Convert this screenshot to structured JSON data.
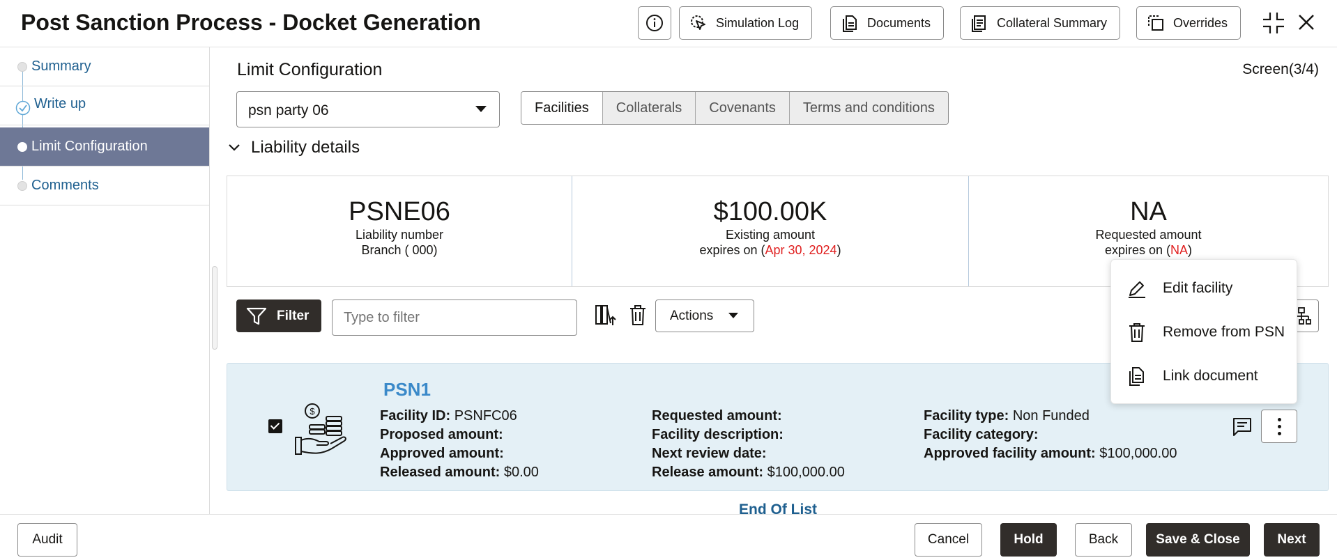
{
  "header": {
    "title": "Post Sanction Process - Docket Generation",
    "buttons": {
      "simulation_log": "Simulation Log",
      "documents": "Documents",
      "collateral_summary": "Collateral Summary",
      "overrides": "Overrides"
    }
  },
  "sidebar": {
    "items": [
      {
        "label": "Summary",
        "state": "pending"
      },
      {
        "label": "Write up",
        "state": "completed"
      },
      {
        "label": "Limit Configuration",
        "state": "active"
      },
      {
        "label": "Comments",
        "state": "pending"
      }
    ]
  },
  "main": {
    "section_title": "Limit Configuration",
    "screen_indicator": "Screen(3/4)",
    "party_select": "psn party 06",
    "tabs": [
      "Facilities",
      "Collaterals",
      "Covenants",
      "Terms and conditions"
    ],
    "liability_header": "Liability details",
    "liability": {
      "number": {
        "value": "PSNE06",
        "label": "Liability number",
        "branch": "Branch ( 000)"
      },
      "existing": {
        "value": "$100.00K",
        "label": "Existing amount",
        "expires_prefix": "expires on (",
        "expires_date": "Apr 30, 2024",
        "expires_suffix": ")"
      },
      "requested": {
        "value": "NA",
        "label": "Requested amount",
        "expires_prefix": "expires on (",
        "expires_date": "NA",
        "expires_suffix": ")"
      }
    },
    "toolbar": {
      "filter_label": "Filter",
      "filter_placeholder": "Type to filter",
      "actions_label": "Actions"
    },
    "facility": {
      "name": "PSN1",
      "checked": true,
      "facility_id_label": "Facility ID:",
      "facility_id": "PSNFC06",
      "proposed_amount_label": "Proposed amount:",
      "approved_amount_label": "Approved amount:",
      "released_amount_label": "Released amount:",
      "released_amount": "$0.00",
      "requested_amount_label": "Requested amount:",
      "facility_description_label": "Facility description:",
      "next_review_date_label": "Next review date:",
      "release_amount_label": "Release amount:",
      "release_amount": "$100,000.00",
      "facility_type_label": "Facility type:",
      "facility_type": "Non Funded",
      "facility_category_label": "Facility category:",
      "approved_facility_amount_label": "Approved facility amount:",
      "approved_facility_amount": "$100,000.00"
    },
    "end_of_list": "End Of List",
    "context_menu": [
      "Edit facility",
      "Remove from PSN",
      "Link document"
    ]
  },
  "footer": {
    "audit": "Audit",
    "cancel": "Cancel",
    "hold": "Hold",
    "back": "Back",
    "save_close": "Save & Close",
    "next": "Next"
  },
  "colors": {
    "accent_link": "#1e5f8f",
    "active_nav": "#6e7896",
    "dark_button": "#312d2a",
    "card_bg": "#e4f0f6",
    "expiry_red": "#e01f1f"
  }
}
